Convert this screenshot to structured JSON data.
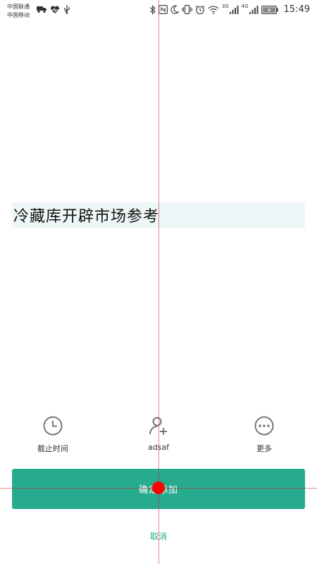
{
  "status_bar": {
    "carrier_1": "中国联通",
    "carrier_2": "中国移动",
    "net_3g": "3G",
    "net_4g": "4G",
    "time": "15:49",
    "left_icons": [
      "truck-icon",
      "heart-pulse-icon",
      "usb-icon"
    ],
    "right_icons": [
      "bluetooth-icon",
      "nfc-icon",
      "moon-icon",
      "vibrate-icon",
      "alarm-icon",
      "wifi-icon",
      "signal-icon",
      "signal-icon",
      "battery-charging-icon"
    ]
  },
  "title": "冷藏库开辟市场参考",
  "actions": [
    {
      "label": "截止时间",
      "icon": "clock-icon"
    },
    {
      "label": "adsaf",
      "icon": "add-person-icon"
    },
    {
      "label": "更多",
      "icon": "more-icon"
    }
  ],
  "confirm_label": "确定添加",
  "cancel_label": "取消",
  "colors": {
    "accent": "#27ab8e",
    "title_bg": "#eef7f7",
    "icon_gray": "#777777"
  }
}
